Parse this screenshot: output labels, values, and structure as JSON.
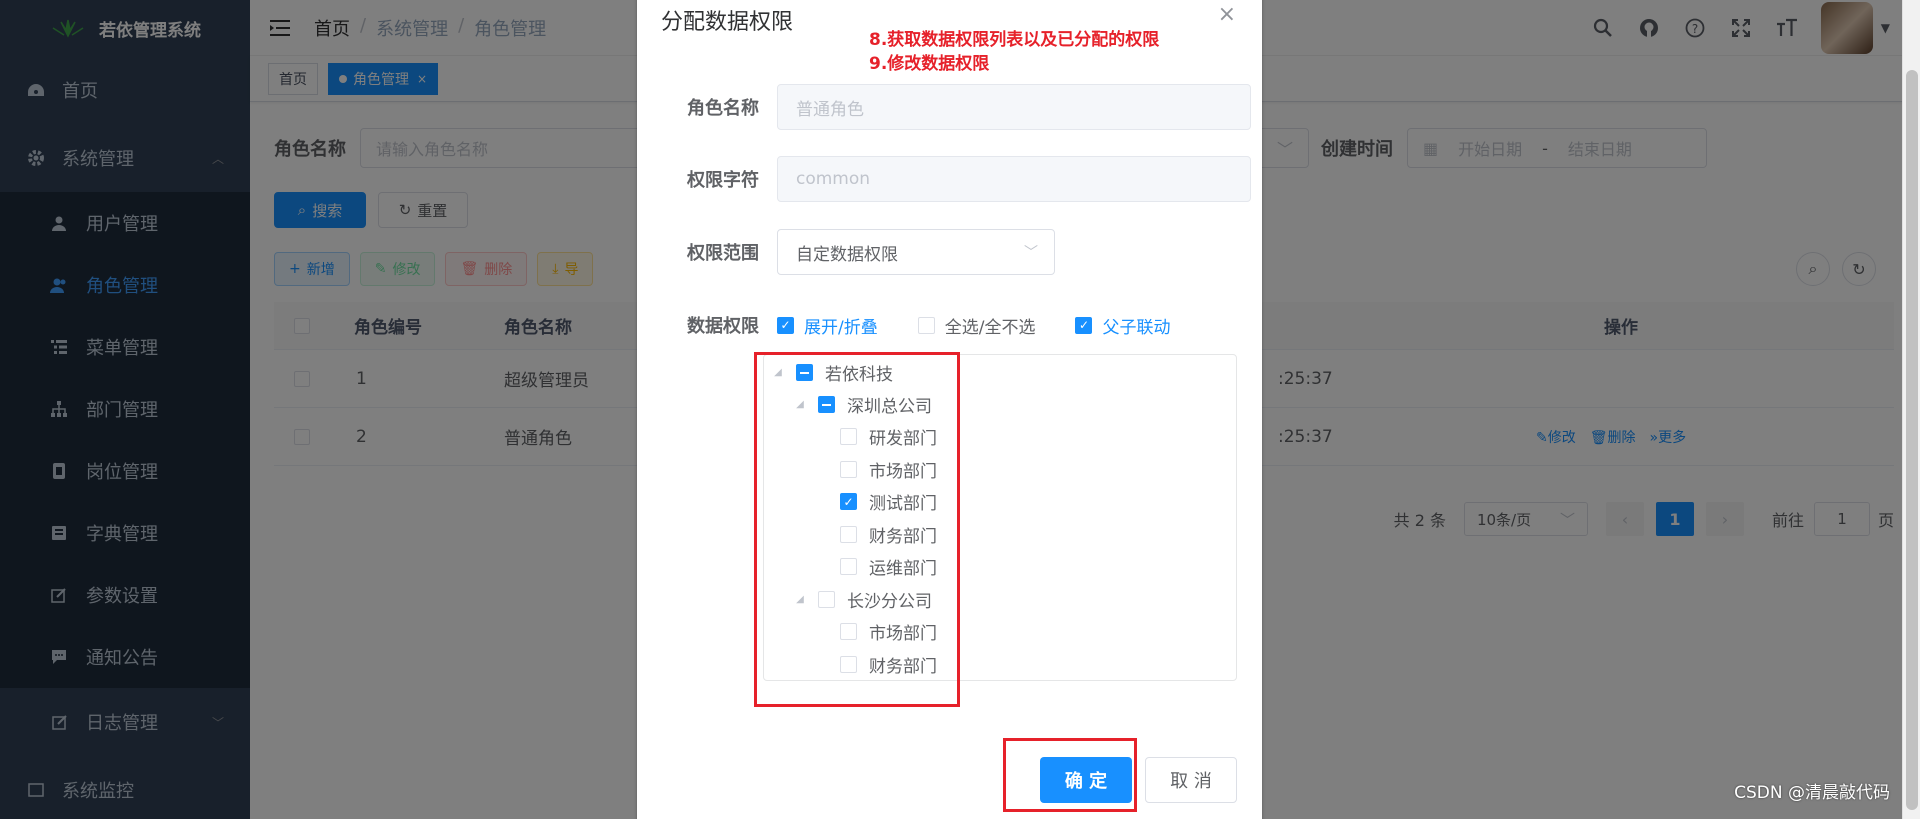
{
  "app": {
    "title": "若依管理系统"
  },
  "sidebar": {
    "home": "首页",
    "system": "系统管理",
    "items": [
      {
        "label": "用户管理",
        "icon": "user-icon"
      },
      {
        "label": "角色管理",
        "icon": "peoples-icon"
      },
      {
        "label": "菜单管理",
        "icon": "tree-table-icon"
      },
      {
        "label": "部门管理",
        "icon": "tree-icon"
      },
      {
        "label": "岗位管理",
        "icon": "post-icon"
      },
      {
        "label": "字典管理",
        "icon": "dict-icon"
      },
      {
        "label": "参数设置",
        "icon": "edit-icon"
      },
      {
        "label": "通知公告",
        "icon": "message-icon"
      },
      {
        "label": "日志管理",
        "icon": "log-icon"
      }
    ],
    "monitor": "系统监控"
  },
  "navbar": {
    "breadcrumb": [
      "首页",
      "系统管理",
      "角色管理"
    ]
  },
  "tags": [
    {
      "label": "首页"
    },
    {
      "label": "角色管理"
    }
  ],
  "search": {
    "role_name_label": "角色名称",
    "role_name_placeholder": "请输入角色名称",
    "created_label": "创建时间",
    "start_placeholder": "开始日期",
    "range_sep": "-",
    "end_placeholder": "结束日期",
    "search_btn": "搜索",
    "reset_btn": "重置"
  },
  "toolbar": {
    "add": "新增",
    "edit": "修改",
    "delete": "删除",
    "export": "导"
  },
  "table": {
    "headers": {
      "id": "角色编号",
      "name": "角色名称",
      "op": "操作"
    },
    "rows": [
      {
        "id": "1",
        "name": "超级管理员",
        "time": ":25:37"
      },
      {
        "id": "2",
        "name": "普通角色",
        "time": ":25:37",
        "edit": "修改",
        "del": "删除",
        "more": "更多"
      }
    ]
  },
  "pager": {
    "total": "共 2 条",
    "size": "10条/页",
    "current": "1",
    "goto_label": "前往",
    "goto_value": "1",
    "page_unit": "页"
  },
  "dialog": {
    "title": "分配数据权限",
    "annotation_1": "8.获取数据权限列表以及已分配的权限",
    "annotation_2": "9.修改数据权限",
    "role_name_label": "角色名称",
    "role_name_value": "普通角色",
    "role_key_label": "权限字符",
    "role_key_value": "common",
    "scope_label": "权限范围",
    "scope_value": "自定数据权限",
    "data_scope_label": "数据权限",
    "expand_label": "展开/折叠",
    "select_all_label": "全选/全不选",
    "linkage_label": "父子联动",
    "confirm_btn": "确 定",
    "cancel_btn": "取 消",
    "tree": [
      {
        "label": "若依科技",
        "state": "half"
      },
      {
        "label": "深圳总公司",
        "state": "half"
      },
      {
        "label": "研发部门",
        "state": "off"
      },
      {
        "label": "市场部门",
        "state": "off"
      },
      {
        "label": "测试部门",
        "state": "on"
      },
      {
        "label": "财务部门",
        "state": "off"
      },
      {
        "label": "运维部门",
        "state": "off"
      },
      {
        "label": "长沙分公司",
        "state": "off"
      },
      {
        "label": "市场部门",
        "state": "off"
      },
      {
        "label": "财务部门",
        "state": "off"
      }
    ]
  },
  "watermark": "CSDN @清晨敲代码",
  "colors": {
    "primary": "#1890ff",
    "sidebar": "#304156",
    "annotation": "#e6212a"
  }
}
